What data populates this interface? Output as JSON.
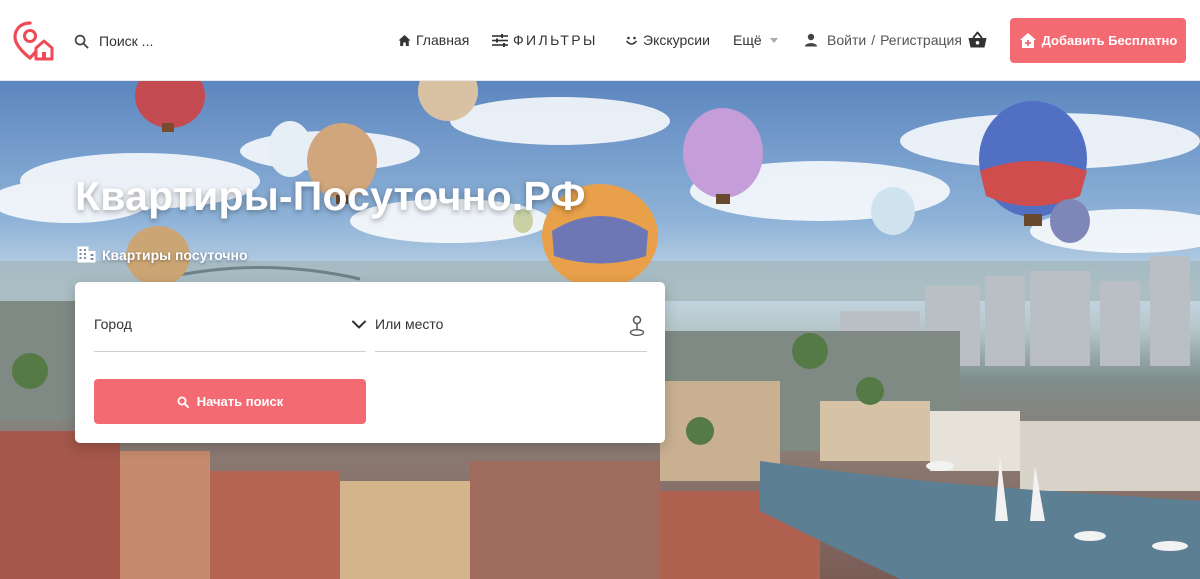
{
  "header": {
    "search_placeholder": "Поиск ...",
    "nav": {
      "home": "Главная",
      "filters": "ФИЛЬТРЫ",
      "tours": "Экскурсии",
      "more": "Ещё"
    },
    "login": "Войти",
    "separator": "/",
    "register": "Регистрация",
    "add_button": "Добавить Бесплатно"
  },
  "hero": {
    "title": "Квартиры-Посуточно.РФ",
    "subtitle": "Квартиры посуточно",
    "search": {
      "city_label": "Город",
      "place_label": "Или место",
      "submit": "Начать поиск"
    }
  },
  "colors": {
    "accent": "#f46a72",
    "logo": "#ef4b56",
    "text": "#333333"
  },
  "icons": [
    "map-pin-home-logo",
    "search-icon",
    "home-icon",
    "sliders-icon",
    "smile-icon",
    "user-icon",
    "basket-icon",
    "add-home-icon",
    "building-icon",
    "chevron-down-icon",
    "location-pin-icon"
  ]
}
